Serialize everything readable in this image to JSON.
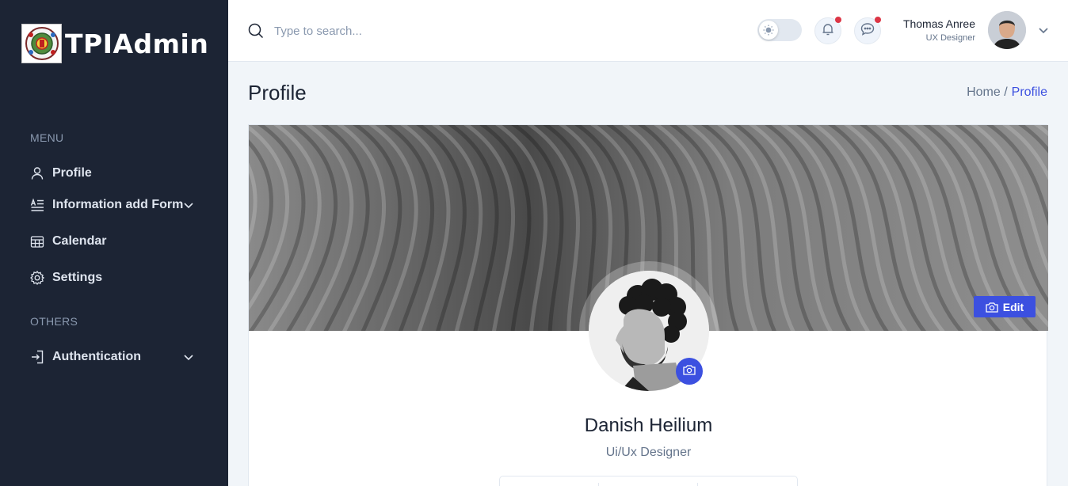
{
  "brand": {
    "name": "TPIAdmin"
  },
  "sidebar": {
    "menu_title": "MENU",
    "others_title": "OTHERS",
    "items": [
      {
        "label": "Profile",
        "icon": "user-icon"
      },
      {
        "label": "Information add Form",
        "icon": "form-icon"
      },
      {
        "label": "Calendar",
        "icon": "calendar-icon"
      },
      {
        "label": "Settings",
        "icon": "gear-icon"
      }
    ],
    "others": [
      {
        "label": "Authentication",
        "icon": "login-icon"
      }
    ]
  },
  "header": {
    "search_placeholder": "Type to search...",
    "user": {
      "name": "Thomas Anree",
      "role": "UX Designer"
    }
  },
  "page": {
    "title": "Profile",
    "breadcrumb": {
      "home": "Home /",
      "current": "Profile"
    }
  },
  "profile": {
    "edit_label": "Edit",
    "name": "Danish Heilium",
    "role": "Ui/Ux Designer"
  },
  "colors": {
    "sidebar_bg": "#1c2434",
    "accent": "#3c50e0",
    "badge": "#dc3545",
    "page_bg": "#f1f5f9"
  }
}
